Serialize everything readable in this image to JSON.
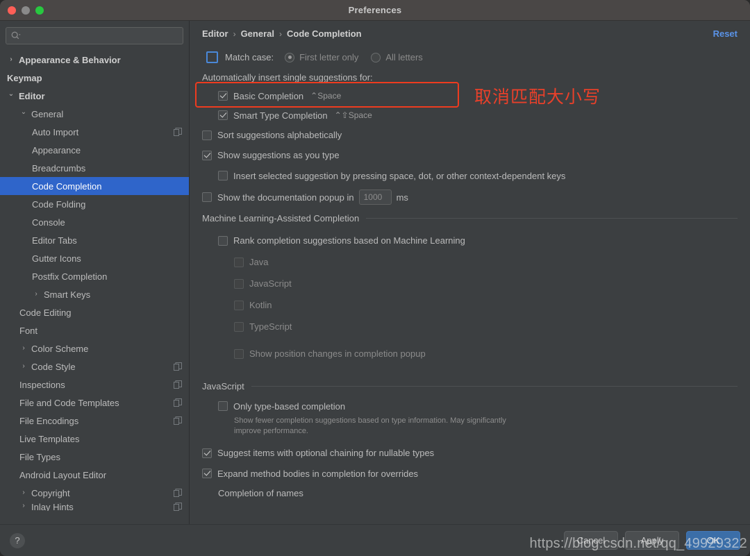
{
  "window": {
    "title": "Preferences",
    "traffic_lights": [
      "close",
      "minimize",
      "zoom"
    ]
  },
  "sidebar": {
    "search": {
      "value": "",
      "placeholder": ""
    },
    "items": [
      {
        "label": "Appearance & Behavior",
        "level": 0,
        "arrow": "collapsed",
        "bold": true,
        "copy": false,
        "selected": false
      },
      {
        "label": "Keymap",
        "level": 0,
        "arrow": "none",
        "bold": true,
        "copy": false,
        "selected": false
      },
      {
        "label": "Editor",
        "level": 0,
        "arrow": "expanded",
        "bold": true,
        "copy": false,
        "selected": false
      },
      {
        "label": "General",
        "level": 1,
        "arrow": "expanded",
        "bold": false,
        "copy": false,
        "selected": false
      },
      {
        "label": "Auto Import",
        "level": 2,
        "arrow": "none",
        "bold": false,
        "copy": true,
        "selected": false
      },
      {
        "label": "Appearance",
        "level": 2,
        "arrow": "none",
        "bold": false,
        "copy": false,
        "selected": false
      },
      {
        "label": "Breadcrumbs",
        "level": 2,
        "arrow": "none",
        "bold": false,
        "copy": false,
        "selected": false
      },
      {
        "label": "Code Completion",
        "level": 2,
        "arrow": "none",
        "bold": false,
        "copy": false,
        "selected": true
      },
      {
        "label": "Code Folding",
        "level": 2,
        "arrow": "none",
        "bold": false,
        "copy": false,
        "selected": false
      },
      {
        "label": "Console",
        "level": 2,
        "arrow": "none",
        "bold": false,
        "copy": false,
        "selected": false
      },
      {
        "label": "Editor Tabs",
        "level": 2,
        "arrow": "none",
        "bold": false,
        "copy": false,
        "selected": false
      },
      {
        "label": "Gutter Icons",
        "level": 2,
        "arrow": "none",
        "bold": false,
        "copy": false,
        "selected": false
      },
      {
        "label": "Postfix Completion",
        "level": 2,
        "arrow": "none",
        "bold": false,
        "copy": false,
        "selected": false
      },
      {
        "label": "Smart Keys",
        "level": 2,
        "arrow": "collapsed",
        "bold": false,
        "copy": false,
        "selected": false
      },
      {
        "label": "Code Editing",
        "level": 1,
        "arrow": "none",
        "bold": false,
        "copy": false,
        "selected": false
      },
      {
        "label": "Font",
        "level": 1,
        "arrow": "none",
        "bold": false,
        "copy": false,
        "selected": false
      },
      {
        "label": "Color Scheme",
        "level": 1,
        "arrow": "collapsed",
        "bold": false,
        "copy": false,
        "selected": false
      },
      {
        "label": "Code Style",
        "level": 1,
        "arrow": "collapsed",
        "bold": false,
        "copy": true,
        "selected": false
      },
      {
        "label": "Inspections",
        "level": 1,
        "arrow": "none",
        "bold": false,
        "copy": true,
        "selected": false
      },
      {
        "label": "File and Code Templates",
        "level": 1,
        "arrow": "none",
        "bold": false,
        "copy": true,
        "selected": false
      },
      {
        "label": "File Encodings",
        "level": 1,
        "arrow": "none",
        "bold": false,
        "copy": true,
        "selected": false
      },
      {
        "label": "Live Templates",
        "level": 1,
        "arrow": "none",
        "bold": false,
        "copy": false,
        "selected": false
      },
      {
        "label": "File Types",
        "level": 1,
        "arrow": "none",
        "bold": false,
        "copy": false,
        "selected": false
      },
      {
        "label": "Android Layout Editor",
        "level": 1,
        "arrow": "none",
        "bold": false,
        "copy": false,
        "selected": false
      },
      {
        "label": "Copyright",
        "level": 1,
        "arrow": "collapsed",
        "bold": false,
        "copy": true,
        "selected": false
      },
      {
        "label": "Inlay Hints",
        "level": 1,
        "arrow": "collapsed",
        "bold": false,
        "copy": true,
        "selected": false,
        "clipped": true
      }
    ]
  },
  "main": {
    "breadcrumb": [
      "Editor",
      "General",
      "Code Completion"
    ],
    "breadcrumb_separator": "›",
    "reset_label": "Reset",
    "match_case": {
      "label": "Match case:",
      "checked": false,
      "options": [
        {
          "label": "First letter only",
          "selected": true
        },
        {
          "label": "All letters",
          "selected": false
        }
      ]
    },
    "auto_insert_label": "Automatically insert single suggestions for:",
    "auto_insert_items": [
      {
        "label": "Basic Completion",
        "shortcut": "⌃Space",
        "checked": true
      },
      {
        "label": "Smart Type Completion",
        "shortcut": "⌃⇧Space",
        "checked": true
      }
    ],
    "sort_alphabetically": {
      "label": "Sort suggestions alphabetically",
      "checked": false
    },
    "show_as_you_type": {
      "label": "Show suggestions as you type",
      "checked": true
    },
    "insert_selected": {
      "label": "Insert selected suggestion by pressing space, dot, or other context-dependent keys",
      "checked": false
    },
    "doc_popup": {
      "label_before": "Show the documentation popup in",
      "value": "1000",
      "unit": "ms",
      "checked": false
    },
    "ml_section_title": "Machine Learning-Assisted Completion",
    "ml_rank": {
      "label": "Rank completion suggestions based on Machine Learning",
      "checked": false
    },
    "ml_languages": [
      {
        "label": "Java",
        "checked": false,
        "disabled": true
      },
      {
        "label": "JavaScript",
        "checked": false,
        "disabled": true
      },
      {
        "label": "Kotlin",
        "checked": false,
        "disabled": true
      },
      {
        "label": "TypeScript",
        "checked": false,
        "disabled": true
      }
    ],
    "ml_position_changes": {
      "label": "Show position changes in completion popup",
      "checked": false,
      "disabled": true
    },
    "js_section_title": "JavaScript",
    "js_only_type_based": {
      "label": "Only type-based completion",
      "checked": false,
      "hint": "Show fewer completion suggestions based on type information. May significantly improve performance."
    },
    "js_optional_chaining": {
      "label": "Suggest items with optional chaining for nullable types",
      "checked": true
    },
    "js_expand_bodies": {
      "label": "Expand method bodies in completion for overrides",
      "checked": true
    },
    "completion_of_names_title": "Completion of names"
  },
  "annotation": {
    "text": "取消匹配大小写",
    "color": "#e8402a"
  },
  "footer": {
    "help_label": "?",
    "cancel_label": "Cancel",
    "apply_label": "Apply",
    "ok_label": "OK"
  },
  "watermark": {
    "text": "https://blog.csdn.net/qq_49929322"
  },
  "colors": {
    "window_bg": "#3c3f41",
    "titlebar_bg": "#4a4746",
    "selection_blue": "#2f65ca",
    "link_blue": "#5a93e8",
    "primary_button": "#3b6ea8",
    "annotation_red": "#e8402a",
    "highlight_border": "#ee3b1f"
  }
}
